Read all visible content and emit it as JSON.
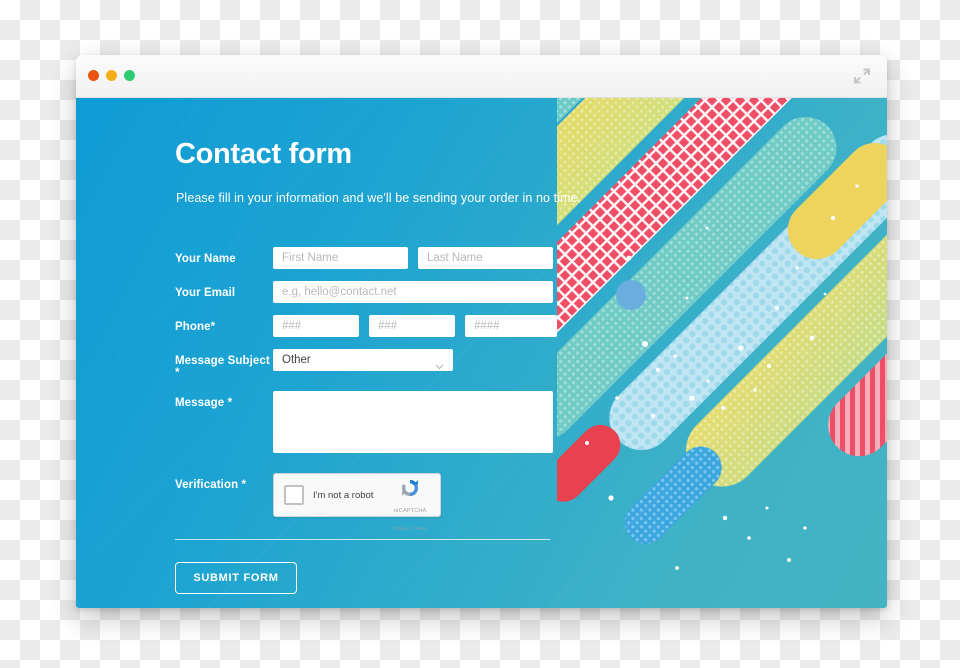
{
  "window": {
    "traffic_lights": [
      {
        "name": "close",
        "color": "#e8540f"
      },
      {
        "name": "minimize",
        "color": "#f4af19"
      },
      {
        "name": "zoom",
        "color": "#2ecc71"
      }
    ],
    "expand_icon": "expand-arrows-icon"
  },
  "header": {
    "title": "Contact form",
    "subtitle": "Please fill in your information and we'll be sending your order in no time."
  },
  "form": {
    "rows": [
      {
        "label": "Your Name",
        "fields": [
          {
            "name": "first-name-input",
            "placeholder": "First Name",
            "value": ""
          },
          {
            "name": "last-name-input",
            "placeholder": "Last Name",
            "value": ""
          }
        ]
      },
      {
        "label": "Your Email",
        "fields": [
          {
            "name": "email-input",
            "placeholder": "e.g, hello@contact.net",
            "value": ""
          }
        ]
      },
      {
        "label": "Phone*",
        "fields": [
          {
            "name": "phone-area-input",
            "placeholder": "###",
            "value": ""
          },
          {
            "name": "phone-prefix-input",
            "placeholder": "###",
            "value": ""
          },
          {
            "name": "phone-line-input",
            "placeholder": "####",
            "value": ""
          }
        ]
      }
    ],
    "subject": {
      "label": "Message Subject *",
      "selected": "Other",
      "options": [
        "Other"
      ],
      "chevron": "chevron-down-icon"
    },
    "message": {
      "label": "Message *",
      "placeholder": "",
      "value": ""
    },
    "verification": {
      "label": "Verification *",
      "checkbox_label": "I'm not a robot",
      "brand": "reCAPTCHA",
      "terms": "Privacy - Terms",
      "logo": "recaptcha-logo-icon",
      "checked": false
    },
    "submit_label": "SUBMIT FORM"
  },
  "theme": {
    "bg_start": "#0f9bd4",
    "bg_end": "#44b4c4",
    "accent_white": "#ffffff",
    "decor_yellow": "#edd45f",
    "decor_green": "#c8dd7e",
    "decor_pink": "#ef4e67",
    "decor_teal": "#62c9c3",
    "decor_blue": "#3aa6e0",
    "decor_red": "#e8414f"
  }
}
